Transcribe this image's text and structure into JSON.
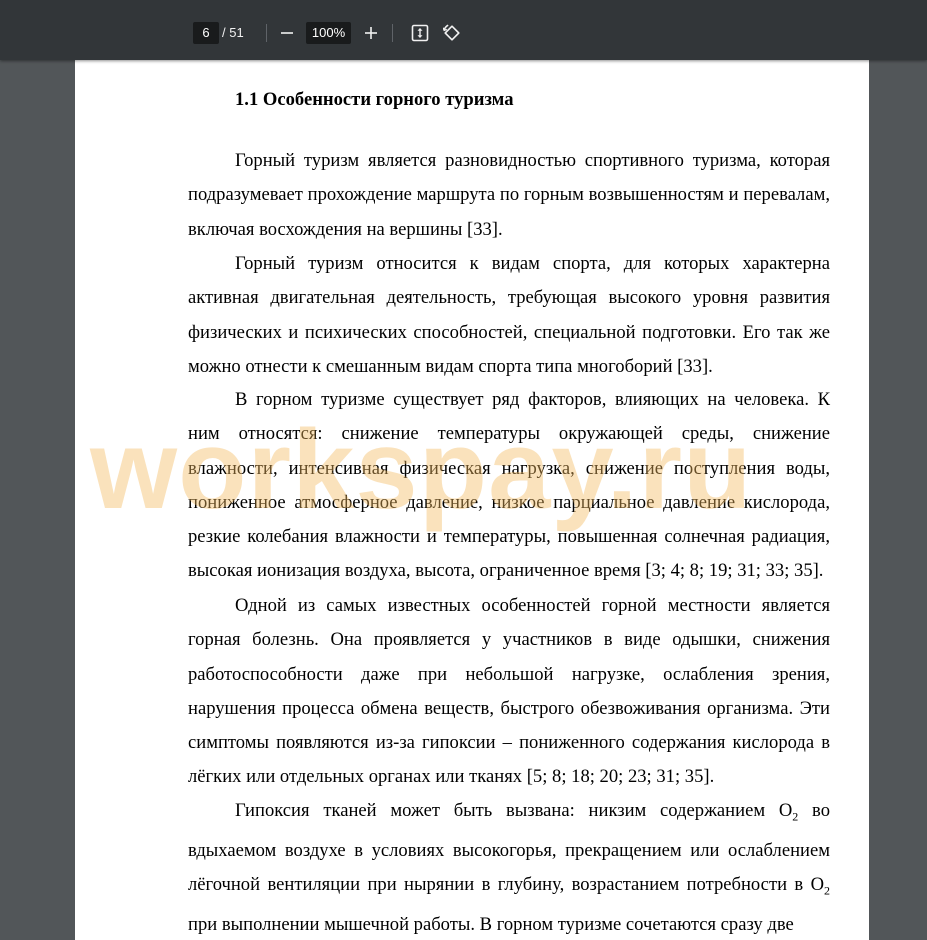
{
  "toolbar": {
    "current_page": "6",
    "total_pages": "/ 51",
    "zoom": "100%",
    "zoom_out_icon": "minus-icon",
    "zoom_in_icon": "plus-icon",
    "fit_icon": "fit-page-icon",
    "rotate_icon": "rotate-icon"
  },
  "document": {
    "heading": "1.1 Особенности горного туризма",
    "paragraphs": [
      "Горный туризм является разновидностью спортивного туризма, которая подразумевает прохождение маршрута по горным возвышенностям и перевалам, включая восхождения на вершины [33].",
      "Горный туризм относится к видам спорта, для которых характерна активная двигательная деятельность, требующая высокого уровня развития физических и психических способностей, специальной подготовки. Его так же можно отнести к смешанным видам спорта типа многоборий [33].",
      "В горном туризме существует ряд факторов, влияющих на человека. К ним относятся: снижение температуры окружающей среды, снижение влажности, интенсивная физическая нагрузка, снижение поступления воды, пониженное атмосферное давление, низкое парциальное давление кислорода, резкие колебания влажности и температуры, повышенная солнечная радиация, высокая ионизация воздуха, высота, ограниченное время [3; 4; 8; 19; 31; 33; 35].",
      "Одной из самых известных особенностей горной местности является горная болезнь. Она проявляется у участников в виде одышки, снижения работоспособности даже при небольшой нагрузке, ослабления зрения, нарушения процесса обмена веществ, быстрого обезвоживания организма. Эти симптомы появляются из-за гипоксии – пониженного содержания кислорода в лёгких или отдельных органах или тканях [5; 8; 18; 20; 23; 31; 35]."
    ],
    "p5_part1": "Гипоксия тканей может быть вызвана: никзим содержанием O",
    "p5_sub1": "2",
    "p5_part2": " во вдыхаемом воздухе в условиях высокогорья, прекращением или ослаблением лёгочной вентиляции при нырянии в глубину, возрастанием потребности в O",
    "p5_sub2": "2",
    "p5_part3": " при выполнении мышечной работы. В горном туризме сочетаются сразу две",
    "watermark": "workspay.ru"
  },
  "colors": {
    "toolbar_bg": "#323639",
    "viewer_bg": "#525659",
    "watermark": "#f4ba60"
  }
}
